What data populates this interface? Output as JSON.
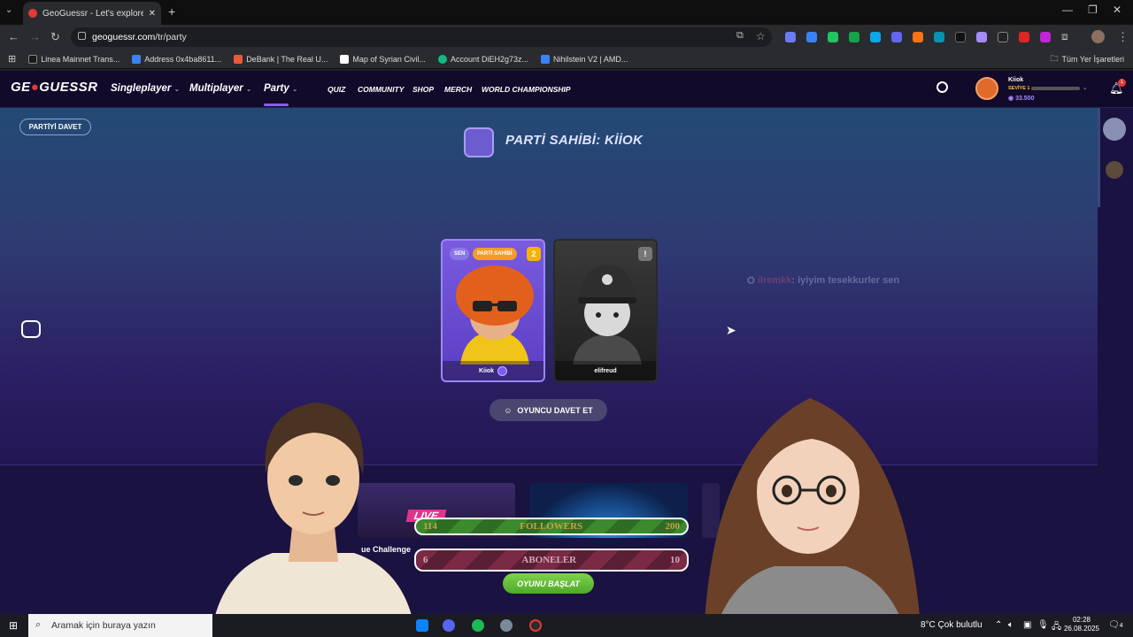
{
  "browser": {
    "tab_title": "GeoGuessr - Let's explore the w",
    "url_host": "geoguessr.com",
    "url_path": "/tr/party",
    "bookmarks": [
      {
        "label": "Linea Mainnet Trans...",
        "color": "#1a1a1a"
      },
      {
        "label": "Address 0x4ba8611...",
        "color": "#3b82f6"
      },
      {
        "label": "DeBank | The Real U...",
        "color": "#e85a3c"
      },
      {
        "label": "Map of Syrian Civil...",
        "color": "#ffffff"
      },
      {
        "label": "Account DiEH2g73z...",
        "color": "#10b981"
      },
      {
        "label": "Nihilstein V2 | AMD...",
        "color": "#3b82f6"
      }
    ],
    "all_bookmarks": "Tüm Yer İşaretleri"
  },
  "header": {
    "logo_pre": "GE",
    "logo_post": "GUESSR",
    "nav": [
      "Singleplayer",
      "Multiplayer",
      "Party"
    ],
    "subnav": [
      "QUIZ",
      "COMMUNITY",
      "SHOP",
      "MERCH",
      "WORLD CHAMPIONSHIP"
    ],
    "user": {
      "name": "Kiiok",
      "level": "SEVİYE 1",
      "coins": "33.500"
    },
    "notification_count": "1"
  },
  "party": {
    "invite_party": "PARTİYİ DAVET",
    "host_title": "PARTİ SAHİBİ: KİİOK",
    "players": [
      {
        "name": "Kiiok",
        "tag_you": "SEN",
        "tag_host": "PARTİ SAHİBİ",
        "level": "2"
      },
      {
        "name": "elifreud",
        "level": "!"
      }
    ],
    "invite_player": "OYUNCU DAVET ET",
    "chat": {
      "user": "ilremkk",
      "message": ": iyiyim tesekkurler sen"
    },
    "start_button": "OYUNU BAŞLAT"
  },
  "modes": {
    "live_label": "LIVE",
    "left_label": "ue Challenge"
  },
  "overlay": {
    "followers": {
      "current": "114",
      "label": "FOLLOWERS",
      "goal": "200"
    },
    "aboneler": {
      "current": "6",
      "label": "ABONELER",
      "goal": "10"
    }
  },
  "taskbar": {
    "search_placeholder": "Aramak için buraya yazın",
    "weather": "8°C  Çok bulutlu",
    "time": "02:28",
    "date": "26.08.2025",
    "notif": "4"
  },
  "colors": {
    "accent": "#8b5cf6",
    "start": "#5cb531",
    "brand_red": "#e53935"
  }
}
